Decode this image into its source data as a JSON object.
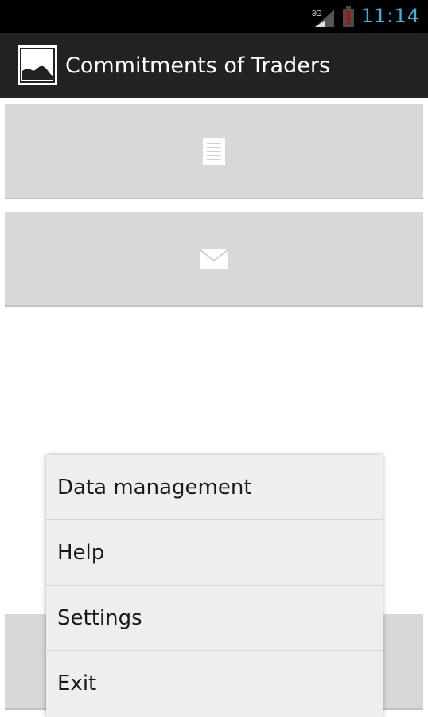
{
  "status_bar": {
    "network": "3G",
    "time": "11:14",
    "icons": [
      "signal-icon",
      "battery-alert-icon"
    ],
    "colors": {
      "clock": "#33b5e5",
      "battery_alert": "#cc0000"
    }
  },
  "action_bar": {
    "title": "Commitments of Traders",
    "icon": "image-placeholder-icon"
  },
  "tiles": [
    {
      "icon": "document-icon"
    },
    {
      "icon": "envelope-icon"
    },
    {
      "icon": ""
    }
  ],
  "menu": {
    "items": [
      {
        "label": "Data management"
      },
      {
        "label": "Help"
      },
      {
        "label": "Settings"
      },
      {
        "label": "Exit"
      }
    ]
  }
}
